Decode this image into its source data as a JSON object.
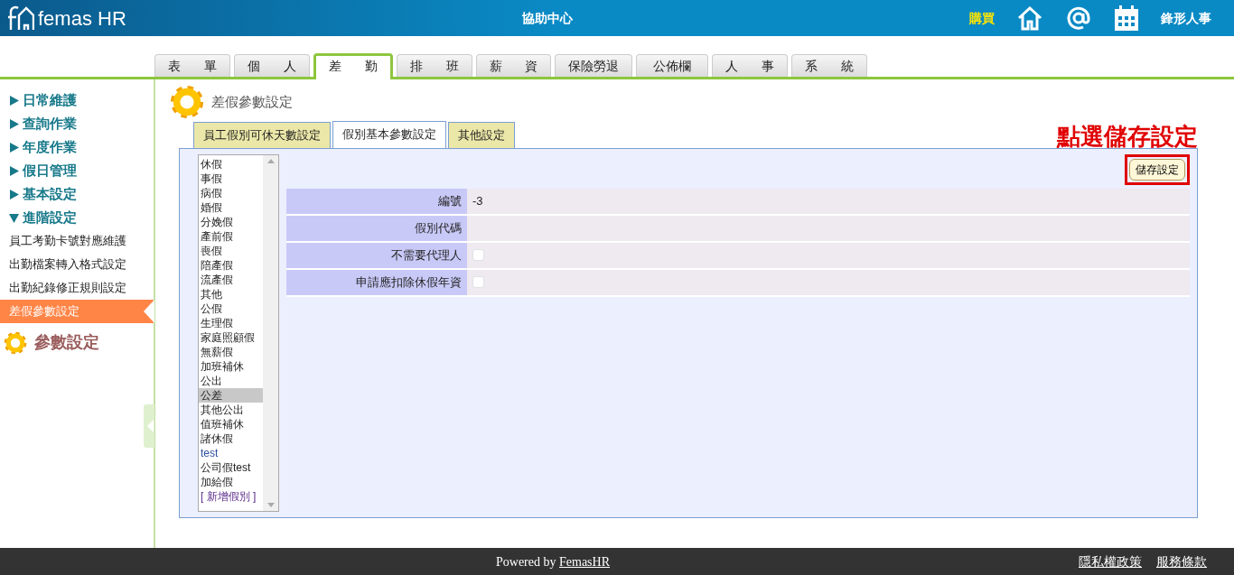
{
  "header": {
    "logo_text": "femas HR",
    "center_title": "協助中心",
    "buy_link": "購買",
    "company": "鋒形人事"
  },
  "main_tabs": [
    {
      "label": "表 單",
      "selected": false
    },
    {
      "label": "個 人",
      "selected": false
    },
    {
      "label": "差 勤",
      "selected": true
    },
    {
      "label": "排 班",
      "selected": false
    },
    {
      "label": "薪 資",
      "selected": false
    },
    {
      "label": "保險勞退",
      "selected": false
    },
    {
      "label": "公佈欄",
      "selected": false
    },
    {
      "label": "人 事",
      "selected": false
    },
    {
      "label": "系 統",
      "selected": false
    }
  ],
  "sidebar": {
    "groups": [
      {
        "label": "日常維護",
        "expanded": false
      },
      {
        "label": "查詢作業",
        "expanded": false
      },
      {
        "label": "年度作業",
        "expanded": false
      },
      {
        "label": "假日管理",
        "expanded": false
      },
      {
        "label": "基本設定",
        "expanded": false
      },
      {
        "label": "進階設定",
        "expanded": true,
        "children": [
          {
            "label": "員工考勤卡號對應維護",
            "selected": false
          },
          {
            "label": "出勤檔案轉入格式設定",
            "selected": false
          },
          {
            "label": "出勤紀錄修正規則設定",
            "selected": false
          },
          {
            "label": "差假參數設定",
            "selected": true
          }
        ]
      }
    ],
    "section": "參數設定"
  },
  "page": {
    "title": "差假參數設定",
    "annotation": "點選儲存設定",
    "save_button": "儲存設定",
    "tabs": [
      {
        "label": "員工假別可休天數設定",
        "selected": false
      },
      {
        "label": "假別基本參數設定",
        "selected": true
      },
      {
        "label": "其他設定",
        "selected": false
      }
    ],
    "leave_types": [
      {
        "label": "休假",
        "kind": "standard",
        "selected": false
      },
      {
        "label": "事假",
        "kind": "standard",
        "selected": false
      },
      {
        "label": "病假",
        "kind": "standard",
        "selected": false
      },
      {
        "label": "婚假",
        "kind": "standard",
        "selected": false
      },
      {
        "label": "分娩假",
        "kind": "standard",
        "selected": false
      },
      {
        "label": "產前假",
        "kind": "standard",
        "selected": false
      },
      {
        "label": "喪假",
        "kind": "standard",
        "selected": false
      },
      {
        "label": "陪產假",
        "kind": "standard",
        "selected": false
      },
      {
        "label": "流產假",
        "kind": "standard",
        "selected": false
      },
      {
        "label": "其他",
        "kind": "standard",
        "selected": false
      },
      {
        "label": "公假",
        "kind": "standard",
        "selected": false
      },
      {
        "label": "生理假",
        "kind": "standard",
        "selected": false
      },
      {
        "label": "家庭照顧假",
        "kind": "standard",
        "selected": false
      },
      {
        "label": "無薪假",
        "kind": "standard",
        "selected": false
      },
      {
        "label": "加班補休",
        "kind": "standard",
        "selected": false
      },
      {
        "label": "公出",
        "kind": "standard",
        "selected": false
      },
      {
        "label": "公差",
        "kind": "standard",
        "selected": true
      },
      {
        "label": "其他公出",
        "kind": "standard",
        "selected": false
      },
      {
        "label": "值班補休",
        "kind": "standard",
        "selected": false
      },
      {
        "label": "諸休假",
        "kind": "standard",
        "selected": false
      },
      {
        "label": "test",
        "kind": "custom",
        "selected": false
      },
      {
        "label": "公司假test",
        "kind": "standard",
        "selected": false
      },
      {
        "label": "加給假",
        "kind": "standard",
        "selected": false
      },
      {
        "label": "[ 新增假別 ]",
        "kind": "add",
        "selected": false
      }
    ],
    "fields": [
      {
        "label": "編號",
        "kind": "text",
        "value": "-3"
      },
      {
        "label": "假別代碼",
        "kind": "text"
      },
      {
        "label": "不需要代理人",
        "kind": "checkbox",
        "checked": false
      },
      {
        "label": "申請應扣除休假年資",
        "kind": "checkbox",
        "checked": false
      }
    ]
  },
  "footer": {
    "powered_by": {
      "text": "Powered by",
      "link": "FemasHR"
    },
    "links": [
      "隱私權政策",
      "服務條款"
    ]
  }
}
